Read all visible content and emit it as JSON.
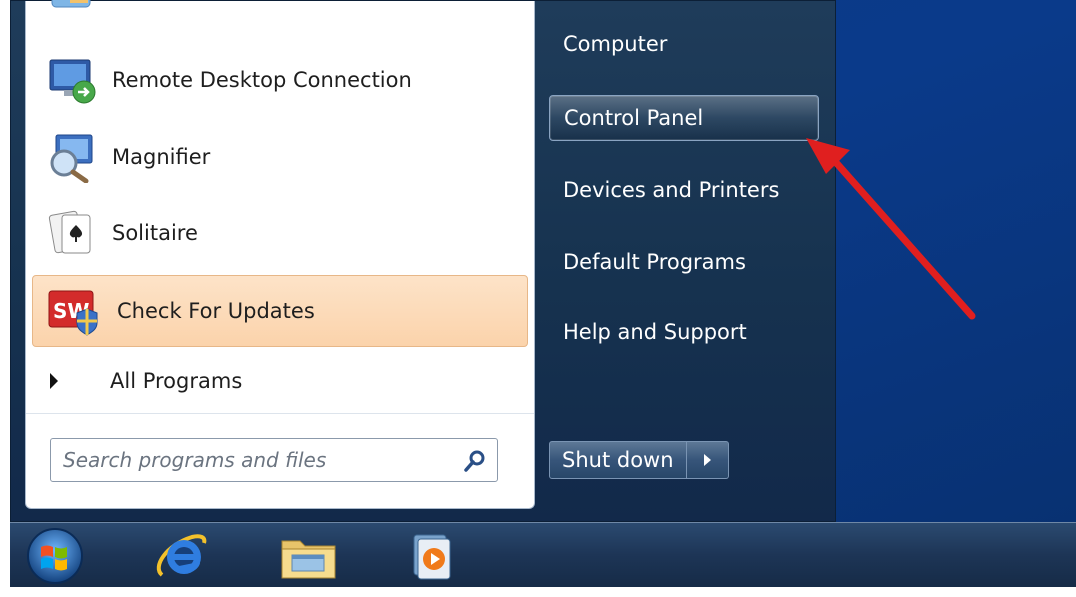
{
  "left_pane": {
    "programs": [
      {
        "label": "Remote Desktop Connection",
        "icon": "remote-desktop-icon"
      },
      {
        "label": "Magnifier",
        "icon": "magnifier-icon"
      },
      {
        "label": "Solitaire",
        "icon": "solitaire-icon"
      },
      {
        "label": "Check For Updates",
        "icon": "solidworks-updates-icon",
        "highlighted": true
      }
    ],
    "all_programs_label": "All Programs",
    "search": {
      "placeholder": "Search programs and files",
      "icon": "search-icon"
    }
  },
  "right_pane": {
    "items": [
      {
        "label": "Computer"
      },
      {
        "label": "Control Panel",
        "highlighted": true
      },
      {
        "label": "Devices and Printers"
      },
      {
        "label": "Default Programs"
      },
      {
        "label": "Help and Support"
      }
    ],
    "shutdown_label": "Shut down"
  },
  "taskbar": {
    "icons": [
      "start-orb-icon",
      "internet-explorer-icon",
      "file-explorer-icon",
      "media-player-icon"
    ]
  },
  "colors": {
    "annotation_arrow": "#e01f1f",
    "highlight": "#fbd3ab",
    "desktop": "#0a3a8a"
  }
}
